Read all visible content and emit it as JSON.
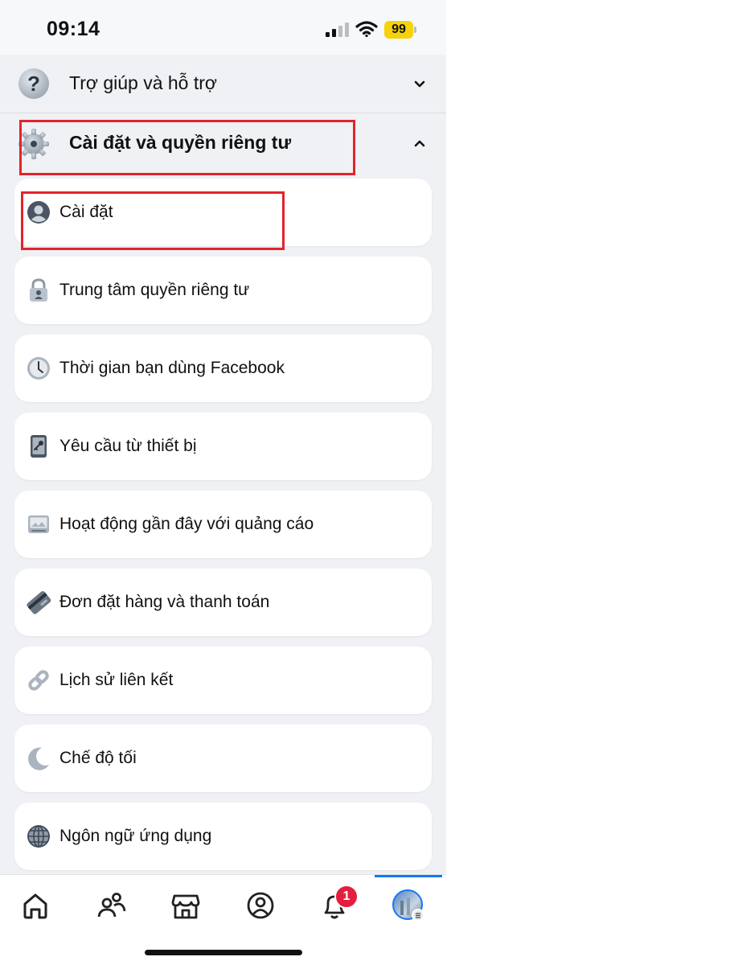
{
  "status_bar": {
    "time": "09:14",
    "battery": "99",
    "icons": [
      "signal-icon",
      "wifi-icon",
      "battery-icon"
    ]
  },
  "sections": {
    "help": {
      "label": "Trợ giúp và hỗ trợ",
      "icon": "question-icon",
      "expanded": false
    },
    "settings": {
      "label": "Cài đặt và quyền riêng tư",
      "icon": "gear-icon",
      "expanded": true
    }
  },
  "menu_items": [
    {
      "label": "Cài đặt",
      "icon": "profile-icon"
    },
    {
      "label": "Trung tâm quyền riêng tư",
      "icon": "lock-icon"
    },
    {
      "label": "Thời gian bạn dùng Facebook",
      "icon": "clock-icon"
    },
    {
      "label": "Yêu cầu từ thiết bị",
      "icon": "phone-key-icon"
    },
    {
      "label": "Hoạt động gần đây với quảng cáo",
      "icon": "ad-image-icon"
    },
    {
      "label": "Đơn đặt hàng và thanh toán",
      "icon": "card-icon"
    },
    {
      "label": "Lịch sử liên kết",
      "icon": "link-icon"
    },
    {
      "label": "Chế độ tối",
      "icon": "moon-icon"
    },
    {
      "label": "Ngôn ngữ ứng dụng",
      "icon": "globe-icon"
    }
  ],
  "bottom_nav": {
    "items": [
      "home-icon",
      "friends-icon",
      "marketplace-icon",
      "profile-icon",
      "notifications-icon",
      "menu-avatar-icon"
    ],
    "notification_count": "1",
    "active": "menu-avatar-icon"
  },
  "colors": {
    "highlight": "#e3232c",
    "accent": "#1877f2",
    "badge": "#e41e3f",
    "battery": "#f5d20a"
  }
}
